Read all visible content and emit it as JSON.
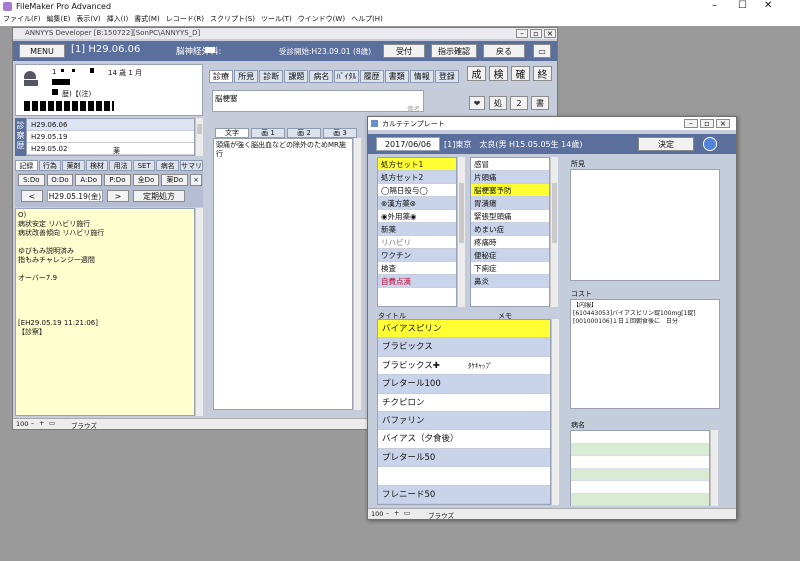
{
  "app": {
    "title": "FileMaker Pro Advanced"
  },
  "menu": [
    "ファイル(F)",
    "編集(E)",
    "表示(V)",
    "挿入(I)",
    "書式(M)",
    "レコード(R)",
    "スクリプト(S)",
    "ツール(T)",
    "ウインドウ(W)",
    "ヘルプ(H)"
  ],
  "sub": {
    "title": "ANNYYS Developer [B:150722][SonPC\\ANNYYS_D]"
  },
  "header": {
    "menu": "MENU",
    "record": "[1] H29.06.06",
    "clinic": "脳神経外科:",
    "visit_start": "受診開始:H23.09.01 (8歳)",
    "reception": "受付",
    "confirm": "指示確認",
    "back": "戻る"
  },
  "patient": {
    "line1_left": "1",
    "line1_right": "14 歳 1 月",
    "line3_tag": "歴)【(注)"
  },
  "side": {
    "label": "診察歴",
    "dates": [
      "H29.06.06",
      "H29.05.19",
      "H29.05.02"
    ],
    "note": "薬"
  },
  "rtabs": [
    "記録",
    "行為",
    "薬剤",
    "検材",
    "用法",
    "SET",
    "病名",
    "サマリ"
  ],
  "do_btns": [
    "S:Do",
    "O:Do",
    "A:Do",
    "P:Do",
    "全Do",
    "薬Do",
    "×"
  ],
  "nav": {
    "prev": "<",
    "date": "H29.05.19(金)",
    "next": ">",
    "fixed": "定期処方"
  },
  "record_text": [
    "O)",
    "病状安定 リハビリ施行",
    "病状改善傾向 リハビリ施行",
    "",
    "ゆびもみ説明済み",
    "指もみチャレンジ一週間",
    "",
    "オーバー7.9",
    "",
    "",
    "",
    "",
    "[EH29.05.19 11:21:06]",
    "【診察】"
  ],
  "mid": {
    "tabs": [
      "診療",
      "所見",
      "診断",
      "課題",
      "病名",
      "ﾊﾞｲﾀﾙ",
      "履歴",
      "書類",
      "情報",
      "登録"
    ],
    "btns": [
      "成",
      "検",
      "確",
      "終"
    ],
    "memo": "脳梗塞",
    "memo_hint": "備考",
    "shortcuts": [
      "処",
      "2",
      "書"
    ],
    "text_tabs": [
      "文字",
      "画 1",
      "画 2",
      "画 3"
    ],
    "note": "頭痛が強く脳出血などの除外のためMR施行"
  },
  "status": {
    "zoom": "100",
    "mode": "ブラウズ"
  },
  "popup": {
    "title": "カルテテンプレート",
    "date": "2017/06/06",
    "patient": "[1]東京　太良(男 H15.05.05生 14歳)",
    "decide": "決定",
    "list1": [
      "処方セット1",
      "処方セット2",
      "◯隔日投与◯",
      "⊗漢方薬⊗",
      "◉外用薬◉",
      "新薬",
      "リハビリ",
      "ワクチン",
      "検査",
      "自費点滴"
    ],
    "list2": [
      "感冒",
      "片頭痛",
      "脳梗塞予防",
      "胃潰瘍",
      "緊張型頭痛",
      "めまい症",
      "疼痛時",
      "便秘症",
      "下痢症",
      "鼻炎"
    ],
    "col_title": "タイトル",
    "col_memo": "メモ",
    "items": [
      {
        "t": "バイアスピリン",
        "m": ""
      },
      {
        "t": "ブラビックス",
        "m": ""
      },
      {
        "t": "ブラビックス✚",
        "m": "ﾀｹｷｬｯﾌﾟ"
      },
      {
        "t": "プレタール100",
        "m": ""
      },
      {
        "t": "チクピロン",
        "m": ""
      },
      {
        "t": "バファリン",
        "m": ""
      },
      {
        "t": "バイアス（夕食後）",
        "m": ""
      },
      {
        "t": "プレタール50",
        "m": ""
      },
      {
        "t": "",
        "m": ""
      },
      {
        "t": "フレニード50",
        "m": ""
      }
    ],
    "findings": "所見",
    "cost": "コスト",
    "cost_lines": [
      "【内服】",
      "[610443053]バイアスピリン錠100mg[1錠]",
      "[001000106]１日１回朝食後に　日分"
    ],
    "disease": "病名"
  }
}
